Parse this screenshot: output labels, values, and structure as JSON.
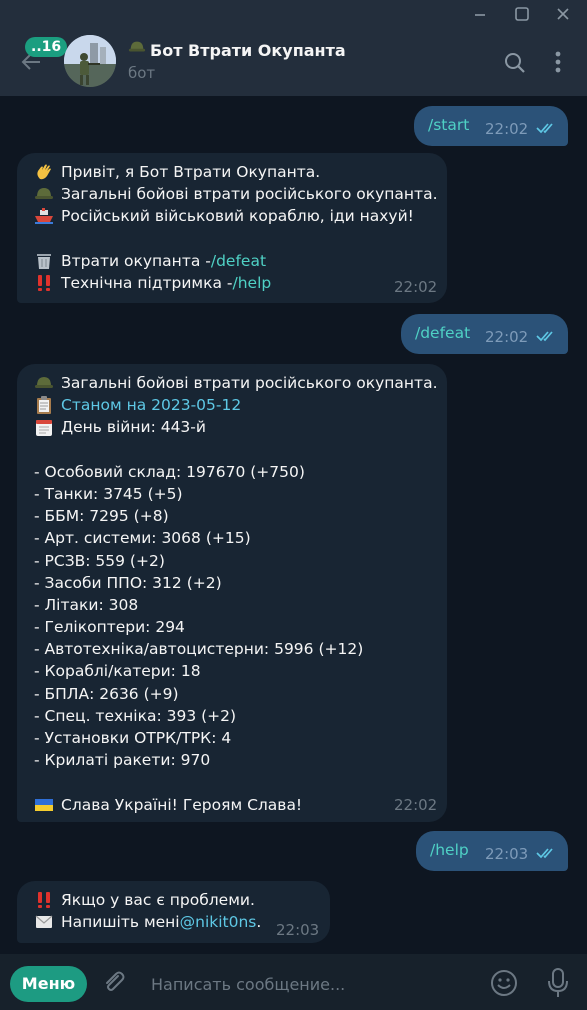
{
  "window": {
    "icons": [
      "minimize-icon",
      "maximize-icon",
      "close-icon"
    ]
  },
  "header": {
    "unread_badge": "..16",
    "title": "Бот Втрати Окупанта",
    "subtitle": "бот"
  },
  "messages": [
    {
      "dir": "out",
      "text": "/start",
      "time": "22:02"
    },
    {
      "dir": "in",
      "lines": [
        {
          "icon": "waving-hand-icon",
          "text": "Привіт, я Бот Втрати Окупанта."
        },
        {
          "icon": "military-helmet-icon",
          "text": "Загальні бойові втрати російського окупанта."
        },
        {
          "icon": "ship-icon",
          "text": "Російський військовий кораблю, іди нахуй!"
        },
        {
          "icon": "",
          "text": ""
        },
        {
          "icon": "wastebasket-icon",
          "text": "Втрати окупанта - ",
          "cmd": "/defeat"
        },
        {
          "icon": "double-exclamation-icon",
          "text": "Технічна підтримка - ",
          "cmd": "/help"
        }
      ],
      "time": "22:02"
    },
    {
      "dir": "out",
      "text": "/defeat",
      "time": "22:02"
    },
    {
      "dir": "in",
      "lines": [
        {
          "icon": "military-helmet-icon",
          "text": "Загальні бойові втрати російського окупанта."
        },
        {
          "icon": "clipboard-icon",
          "link": "Станом на 2023-05-12"
        },
        {
          "icon": "calendar-icon",
          "text": "День війни: 443-й"
        },
        {
          "icon": "",
          "text": ""
        },
        {
          "text": "- Особовий склад: 197670 (+750)"
        },
        {
          "text": "- Танки: 3745 (+5)"
        },
        {
          "text": "- ББМ: 7295 (+8)"
        },
        {
          "text": "- Арт. системи: 3068 (+15)"
        },
        {
          "text": "- РСЗВ: 559 (+2)"
        },
        {
          "text": "- Засоби ППО: 312 (+2)"
        },
        {
          "text": "- Літаки: 308"
        },
        {
          "text": "- Гелікоптери: 294"
        },
        {
          "text": "- Автотехніка/автоцистерни: 5996 (+12)"
        },
        {
          "text": "- Кораблі/катери: 18"
        },
        {
          "text": "- БПЛА: 2636 (+9)"
        },
        {
          "text": "- Спец. техніка: 393 (+2)"
        },
        {
          "text": "- Установки ОТРК/ТРК: 4"
        },
        {
          "text": "- Крилаті ракети: 970"
        },
        {
          "icon": "",
          "text": ""
        },
        {
          "icon": "ukraine-flag-icon",
          "text": "Слава Україні! Героям Слава!"
        }
      ],
      "time": "22:02"
    },
    {
      "dir": "out",
      "text": "/help",
      "time": "22:03"
    },
    {
      "dir": "in",
      "lines": [
        {
          "icon": "double-exclamation-icon",
          "text": "Якщо у вас є проблеми."
        },
        {
          "icon": "envelope-icon",
          "text": "Напишіть мені ",
          "link": "@nikit0ns",
          "after": "."
        }
      ],
      "time": "22:03"
    }
  ],
  "composer": {
    "menu_label": "Меню",
    "placeholder": "Написать сообщение..."
  },
  "colors": {
    "background": "#0e1621",
    "incoming_bubble": "#182533",
    "outgoing_bubble": "#2b5278",
    "accent": "#1d9b82",
    "link": "#5ec8e5"
  }
}
